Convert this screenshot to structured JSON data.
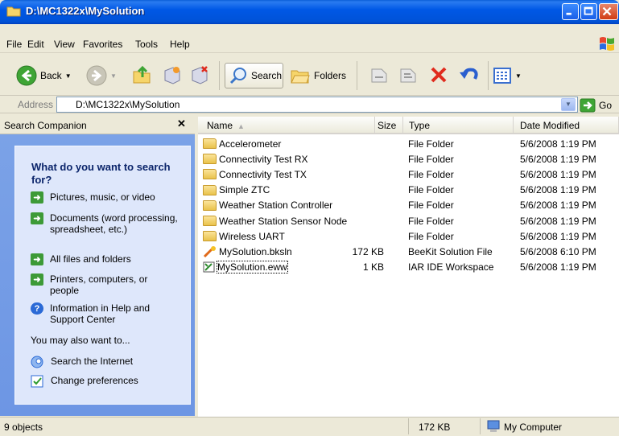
{
  "window": {
    "title": "D:\\MC1322x\\MySolution"
  },
  "menu": [
    "File",
    "Edit",
    "View",
    "Favorites",
    "Tools",
    "Help"
  ],
  "toolbar": {
    "back": "Back",
    "search": "Search",
    "folders": "Folders",
    "go": "Go"
  },
  "address": {
    "label": "Address",
    "value": "D:\\MC1322x\\MySolution"
  },
  "search_pane": {
    "header": "Search Companion",
    "question": "What do you want to search for?",
    "options": [
      "Pictures, music, or video",
      "Documents (word processing, spreadsheet, etc.)",
      "All files and folders",
      "Printers, computers, or people",
      "Information in Help and Support Center"
    ],
    "also_label": "You may also want to...",
    "extra": [
      "Search the Internet",
      "Change preferences"
    ]
  },
  "columns": {
    "name": "Name",
    "size": "Size",
    "type": "Type",
    "date": "Date Modified"
  },
  "files": [
    {
      "name": "Accelerometer",
      "size": "",
      "type": "File Folder",
      "date": "5/6/2008 1:19 PM",
      "icon": "folder-icon"
    },
    {
      "name": "Connectivity Test RX",
      "size": "",
      "type": "File Folder",
      "date": "5/6/2008 1:19 PM",
      "icon": "folder-icon"
    },
    {
      "name": "Connectivity Test TX",
      "size": "",
      "type": "File Folder",
      "date": "5/6/2008 1:19 PM",
      "icon": "folder-icon"
    },
    {
      "name": "Simple ZTC",
      "size": "",
      "type": "File Folder",
      "date": "5/6/2008 1:19 PM",
      "icon": "folder-icon"
    },
    {
      "name": "Weather Station Controller",
      "size": "",
      "type": "File Folder",
      "date": "5/6/2008 1:19 PM",
      "icon": "folder-icon"
    },
    {
      "name": "Weather Station Sensor Node",
      "size": "",
      "type": "File Folder",
      "date": "5/6/2008 1:19 PM",
      "icon": "folder-icon"
    },
    {
      "name": "Wireless UART",
      "size": "",
      "type": "File Folder",
      "date": "5/6/2008 1:19 PM",
      "icon": "folder-icon"
    },
    {
      "name": "MySolution.bksln",
      "size": "172 KB",
      "type": "BeeKit Solution File",
      "date": "5/6/2008 6:10 PM",
      "icon": "beekit-file-icon"
    },
    {
      "name": "MySolution.eww",
      "size": "1 KB",
      "type": "IAR IDE Workspace",
      "date": "5/6/2008 1:19 PM",
      "icon": "iar-workspace-icon"
    }
  ],
  "status": {
    "objects": "9 objects",
    "size": "172 KB",
    "location": "My Computer"
  }
}
